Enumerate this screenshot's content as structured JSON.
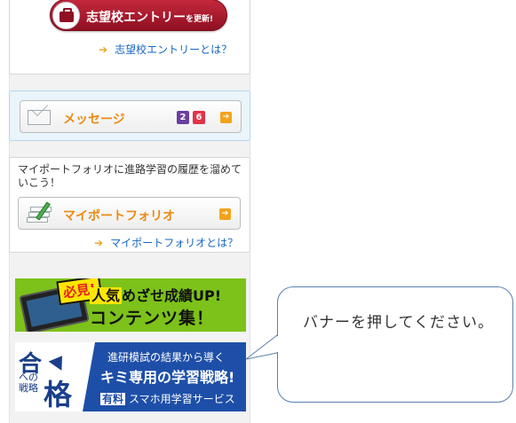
{
  "entry": {
    "button_main": "志望校エントリー",
    "button_small": "を更新!",
    "help_link": "志望校エントリーとは？"
  },
  "message": {
    "label": "メッセージ",
    "badges": [
      {
        "value": "2",
        "color": "#6a3fa0"
      },
      {
        "value": "6",
        "color": "#e0334a"
      }
    ]
  },
  "portfolio": {
    "description": "マイポートフォリオに進路学習の履歴を溜めていこう！",
    "button_label": "マイポートフォリオ",
    "help_link": "マイポートフォリオとは？"
  },
  "banner_contents": {
    "tag": "必見!",
    "line1_highlight": "人気",
    "line1_rest": "めざせ成績UP!",
    "line2": "コンテンツ集！"
  },
  "banner_strategy": {
    "logo_top": "合",
    "logo_side": "への戦略",
    "logo_bottom": "格",
    "line1": "進研模試の結果から導く",
    "line2": "キミ専用の学習戦略!",
    "paid_tag": "有料",
    "line3": "スマホ用学習サービス"
  },
  "callout": {
    "text": "バナーを押してください。"
  },
  "colors": {
    "accent_orange": "#f2a31c",
    "link_blue": "#1565c0",
    "entry_red": "#a8182d",
    "callout_border": "#5b7fb0"
  }
}
